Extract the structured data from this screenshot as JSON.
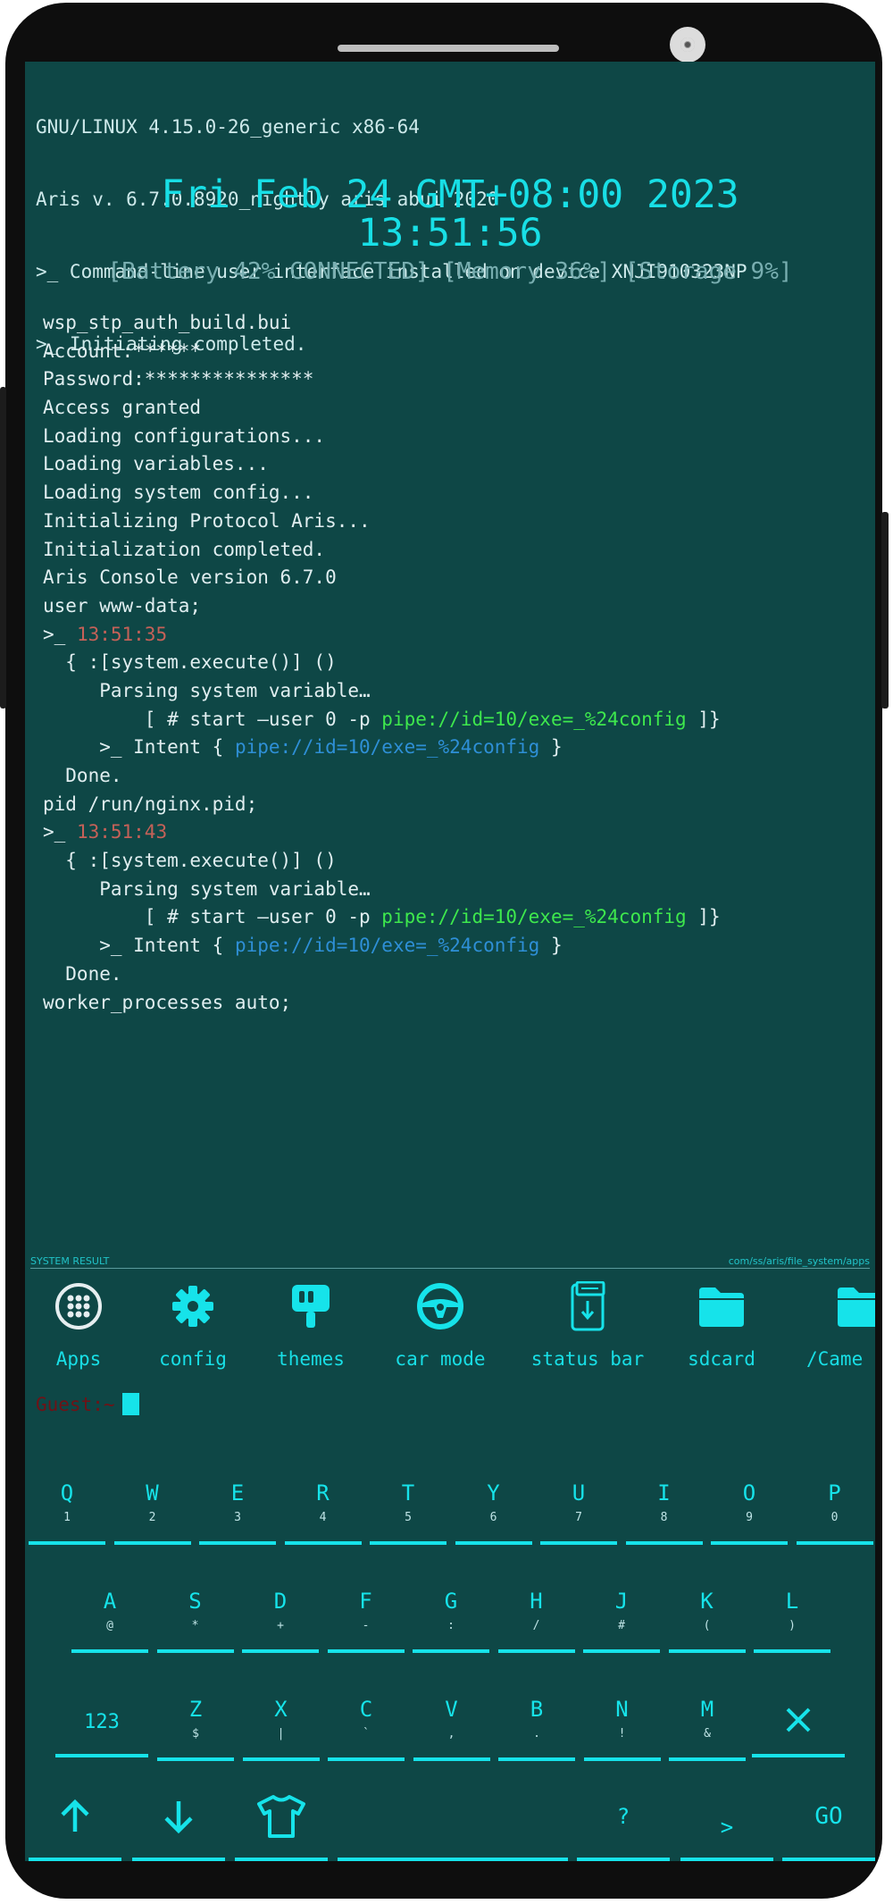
{
  "header_lines": [
    "GNU/LINUX 4.15.0-26_generic x86-64",
    "Aris v. 6.7.0.8920_nightly aris abui 2020",
    ">_ Command-line user interface installed on device XNJI910323NP",
    ">_ Initiating completed."
  ],
  "clock": {
    "date": "Fri Feb 24 GMT+08:00 2023",
    "time": "13:51:56"
  },
  "stats": "[Battery 42% CONNECTED] [Memory 36%] [Storage 9%]",
  "log": [
    [
      {
        "t": "wsp_stp_auth_build.bui"
      }
    ],
    [
      {
        "t": "Account:******"
      }
    ],
    [
      {
        "t": "Password:***************"
      }
    ],
    [
      {
        "t": "Access granted"
      }
    ],
    [
      {
        "t": "Loading configurations..."
      }
    ],
    [
      {
        "t": "Loading variables..."
      }
    ],
    [
      {
        "t": "Loading system config..."
      }
    ],
    [
      {
        "t": "Initializing Protocol Aris..."
      }
    ],
    [
      {
        "t": "Initialization completed."
      }
    ],
    [
      {
        "t": "Aris Console version 6.7.0"
      }
    ],
    [
      {
        "t": "user www-data;"
      }
    ],
    [
      {
        "t": ">_ "
      },
      {
        "t": "13:51:35",
        "c": "red"
      }
    ],
    [
      {
        "t": "  { :[system.execute()] ()"
      }
    ],
    [
      {
        "t": "     Parsing system variable…"
      }
    ],
    [
      {
        "t": "         [ # start —user 0 -p "
      },
      {
        "t": "pipe://id=10/exe=_%24config",
        "c": "green"
      },
      {
        "t": " ]}"
      }
    ],
    [
      {
        "t": "     >_ Intent { "
      },
      {
        "t": "pipe://id=10/exe=_%24config",
        "c": "blue"
      },
      {
        "t": " }"
      }
    ],
    [
      {
        "t": "  Done."
      }
    ],
    [
      {
        "t": "pid /run/nginx.pid;"
      }
    ],
    [
      {
        "t": ">_ "
      },
      {
        "t": "13:51:43",
        "c": "red"
      }
    ],
    [
      {
        "t": "  { :[system.execute()] ()"
      }
    ],
    [
      {
        "t": "     Parsing system variable…"
      }
    ],
    [
      {
        "t": "         [ # start —user 0 -p "
      },
      {
        "t": "pipe://id=10/exe=_%24config",
        "c": "green"
      },
      {
        "t": " ]}"
      }
    ],
    [
      {
        "t": "     >_ Intent { "
      },
      {
        "t": "pipe://id=10/exe=_%24config",
        "c": "blue"
      },
      {
        "t": " }"
      }
    ],
    [
      {
        "t": "  Done."
      }
    ],
    [
      {
        "t": "worker_processes auto;"
      }
    ]
  ],
  "system_bar": {
    "left": "SYSTEM RESULT",
    "right": "com/ss/aris/file_system/apps"
  },
  "apps": [
    {
      "label": "Apps",
      "icon": "apps-grid-icon"
    },
    {
      "label": "config",
      "icon": "gear-icon"
    },
    {
      "label": "themes",
      "icon": "paint-roller-icon"
    },
    {
      "label": "car mode",
      "icon": "steering-wheel-icon"
    },
    {
      "label": "status bar",
      "icon": "phone-status-icon"
    },
    {
      "label": "sdcard",
      "icon": "folder-icon"
    },
    {
      "label": "/Came",
      "icon": "folder-icon"
    }
  ],
  "prompt": "Guest:~",
  "keyboard": {
    "row1": [
      [
        "Q",
        "1"
      ],
      [
        "W",
        "2"
      ],
      [
        "E",
        "3"
      ],
      [
        "R",
        "4"
      ],
      [
        "T",
        "5"
      ],
      [
        "Y",
        "6"
      ],
      [
        "U",
        "7"
      ],
      [
        "I",
        "8"
      ],
      [
        "O",
        "9"
      ],
      [
        "P",
        "0"
      ]
    ],
    "row2": [
      [
        "A",
        "@"
      ],
      [
        "S",
        "*"
      ],
      [
        "D",
        "+"
      ],
      [
        "F",
        "-"
      ],
      [
        "G",
        ":"
      ],
      [
        "H",
        "/"
      ],
      [
        "J",
        "#"
      ],
      [
        "K",
        "("
      ],
      [
        "L",
        ")"
      ]
    ],
    "row3": [
      [
        "Z",
        "$"
      ],
      [
        "X",
        "|"
      ],
      [
        "C",
        "`"
      ],
      [
        "V",
        ","
      ],
      [
        "B",
        "."
      ],
      [
        "N",
        "!"
      ],
      [
        "M",
        "&"
      ]
    ],
    "num_key": "123",
    "question": "?",
    "gt": ">",
    "go": "GO"
  },
  "colors": {
    "screen_bg": "#0e4746",
    "accent": "#16e3ea",
    "timestamp": "#c56158",
    "pipe_green": "#3ee84d",
    "pipe_blue": "#2e8fd6"
  }
}
